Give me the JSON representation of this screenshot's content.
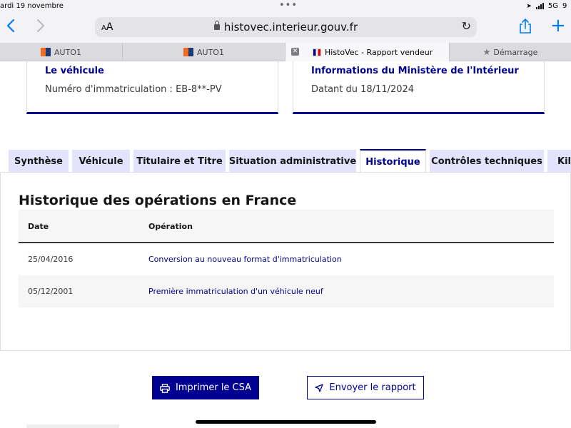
{
  "status_bar": {
    "time": "ardi 19 novembre",
    "network": "5G",
    "battery": "9"
  },
  "browser": {
    "url": "histovec.interieur.gouv.fr",
    "aa_small": "A",
    "aa_large": "A",
    "tabs": [
      {
        "label": "AUTO1"
      },
      {
        "label": "AUTO1"
      },
      {
        "label": "HistoVec - Rapport vendeur"
      },
      {
        "label": "Démarrage"
      }
    ]
  },
  "cards": {
    "vehicle": {
      "title": "Le véhicule",
      "value": "Numéro d'immatriculation : EB-8**-PV"
    },
    "ministry": {
      "title": "Informations du Ministère de l'Intérieur",
      "value": "Datant du 18/11/2024"
    }
  },
  "page_tabs": [
    {
      "label": "Synthèse"
    },
    {
      "label": "Véhicule"
    },
    {
      "label": "Titulaire et Titre"
    },
    {
      "label": "Situation administrative"
    },
    {
      "label": "Historique"
    },
    {
      "label": "Contrôles techniques"
    },
    {
      "label": "Kilométrage"
    }
  ],
  "history": {
    "title": "Historique des opérations en France",
    "columns": {
      "date": "Date",
      "operation": "Opération"
    },
    "rows": [
      {
        "date": "25/04/2016",
        "operation": "Conversion au nouveau format d'immatriculation"
      },
      {
        "date": "05/12/2001",
        "operation": "Première immatriculation d'un véhicule neuf"
      }
    ]
  },
  "actions": {
    "print": "Imprimer le CSA",
    "send": "Envoyer le rapport"
  },
  "colors": {
    "primary": "#000091",
    "tab_bg": "#e3e3fd",
    "ios_blue": "#007aff"
  }
}
